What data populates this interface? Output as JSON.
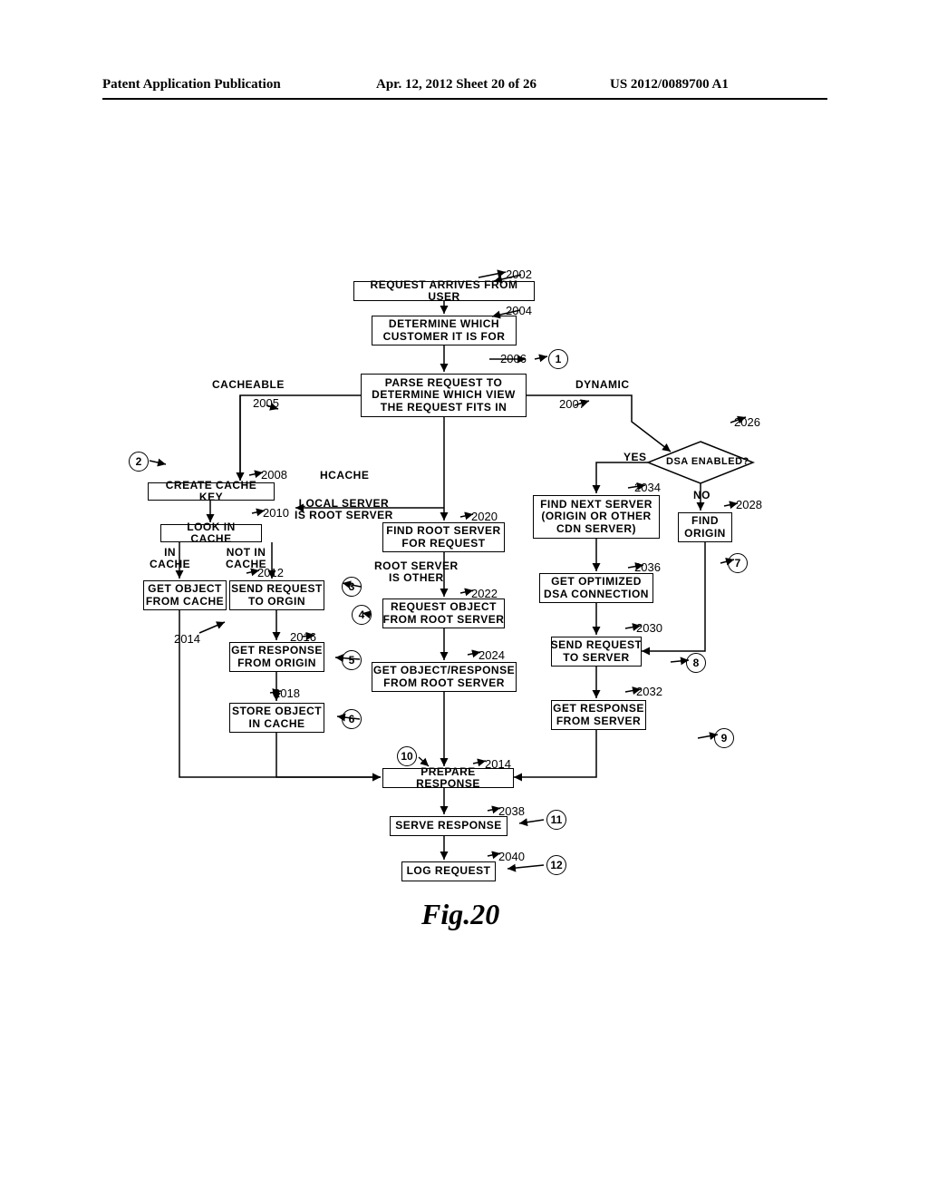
{
  "header": {
    "left": "Patent Application Publication",
    "center": "Apr. 12, 2012  Sheet 20 of 26",
    "right": "US 2012/0089700 A1"
  },
  "figure_label": "Fig.20",
  "boxes": {
    "b2002": "REQUEST ARRIVES FROM USER",
    "b2004": "DETERMINE WHICH\nCUSTOMER IT IS FOR",
    "b2006": "PARSE REQUEST TO\nDETERMINE WHICH VIEW\nTHE REQUEST FITS IN",
    "b2008": "CREATE CACHE KEY",
    "b2010": "LOOK IN CACHE",
    "b2012": "GET OBJECT\nFROM CACHE",
    "b2014send": "SEND REQUEST\nTO ORGIN",
    "b2016": "GET RESPONSE\nFROM ORIGIN",
    "b2018": "STORE OBJECT\nIN CACHE",
    "b2020": "FIND ROOT SERVER\nFOR REQUEST",
    "b2022": "REQUEST OBJECT\nFROM ROOT SERVER",
    "b2024": "GET OBJECT/RESPONSE\nFROM ROOT SERVER",
    "b2034": "FIND NEXT SERVER\n(ORIGIN OR OTHER\nCDN SERVER)",
    "b2036": "GET OPTIMIZED\nDSA CONNECTION",
    "b2028": "FIND\nORIGIN",
    "b2030": "SEND REQUEST\nTO SERVER",
    "b2032": "GET RESPONSE\nFROM SERVER",
    "b2014prep": "PREPARE RESPONSE",
    "b2038": "SERVE RESPONSE",
    "b2040": "LOG REQUEST"
  },
  "refs": {
    "r2002": "2002",
    "r2004": "2004",
    "r2005": "2005",
    "r2006": "2006",
    "r2007": "2007",
    "r2008": "2008",
    "r2010": "2010",
    "r2012": "2012",
    "r2014a": "2014",
    "r2016": "2016",
    "r2018": "2018",
    "r2020": "2020",
    "r2022": "2022",
    "r2024": "2024",
    "r2026": "2026",
    "r2028": "2028",
    "r2030": "2030",
    "r2032": "2032",
    "r2034": "2034",
    "r2036": "2036",
    "r2014b": "2014",
    "r2038": "2038",
    "r2040": "2040"
  },
  "labels": {
    "cacheable": "CACHEABLE",
    "dynamic": "DYNAMIC",
    "hcache": "HCACHE",
    "local_server_root": "LOCAL SERVER\nIS ROOT SERVER",
    "root_server_other": "ROOT SERVER\nIS OTHER",
    "in_cache": "IN\nCACHE",
    "not_in_cache": "NOT IN\nCACHE",
    "yes": "YES",
    "no": "NO",
    "dsa_enabled": "DSA ENABLED?"
  },
  "circles": {
    "c1": "1",
    "c2": "2",
    "c3": "3",
    "c4": "4",
    "c5": "5",
    "c6": "6",
    "c7": "7",
    "c8": "8",
    "c9": "9",
    "c10": "10",
    "c11": "11",
    "c12": "12"
  }
}
